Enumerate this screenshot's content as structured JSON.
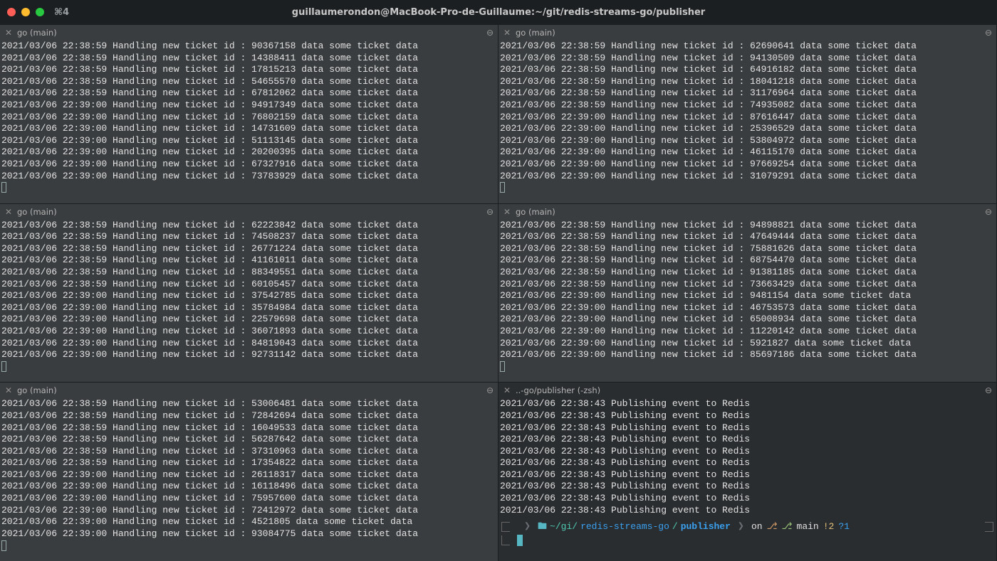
{
  "titlebar": {
    "hotkey": "⌘4",
    "title": "guillaumerondon@MacBook-Pro-de-Guillaume:~/git/redis-streams-go/publisher"
  },
  "go_tab_label": "go (main)",
  "zsh_tab_label": "..-go/publisher (-zsh)",
  "log_prefix_59": "2021/03/06 22:38:59 Handling new ticket id : ",
  "log_prefix_00": "2021/03/06 22:39:00 Handling new ticket id : ",
  "log_suffix": " data some ticket data",
  "publish_prefix": "2021/03/06 22:38:43 Publishing event to Redis",
  "panes": [
    {
      "ids": [
        "90367158",
        "14388411",
        "17815213",
        "54655570",
        "67812062",
        "94917349",
        "76802159",
        "14731609",
        "51113145",
        "20200395",
        "67327916",
        "73783929"
      ],
      "switchAt": 5
    },
    {
      "ids": [
        "62690641",
        "94130509",
        "64916182",
        "18041218",
        "31176964",
        "74935082",
        "87616447",
        "25396529",
        "53804972",
        "46115170",
        "97669254",
        "31079291"
      ],
      "switchAt": 6
    },
    {
      "ids": [
        "62223842",
        "74508237",
        "26771224",
        "41161011",
        "88349551",
        "60105457",
        "37542785",
        "35784984",
        "22579698",
        "36071893",
        "84819043",
        "92731142"
      ],
      "switchAt": 6
    },
    {
      "ids": [
        "94898821",
        "47649444",
        "75881626",
        "68754470",
        "91381185",
        "73663429",
        "9481154",
        "46753573",
        "65008934",
        "11220142",
        "5921827",
        "85697186"
      ],
      "switchAt": 6
    },
    {
      "ids": [
        "53006481",
        "72842694",
        "16049533",
        "56287642",
        "37310963",
        "17354822",
        "26118317",
        "16118496",
        "75957600",
        "72412972",
        "4521805",
        "93084775"
      ],
      "switchAt": 6
    }
  ],
  "publisher_lines_count": 10,
  "prompt": {
    "path_prefix": "~/gi/",
    "path_repo": "redis-streams-go",
    "path_leaf": "publisher",
    "on": "on",
    "branch": "main",
    "dirty": "!2",
    "untracked": "?1"
  }
}
